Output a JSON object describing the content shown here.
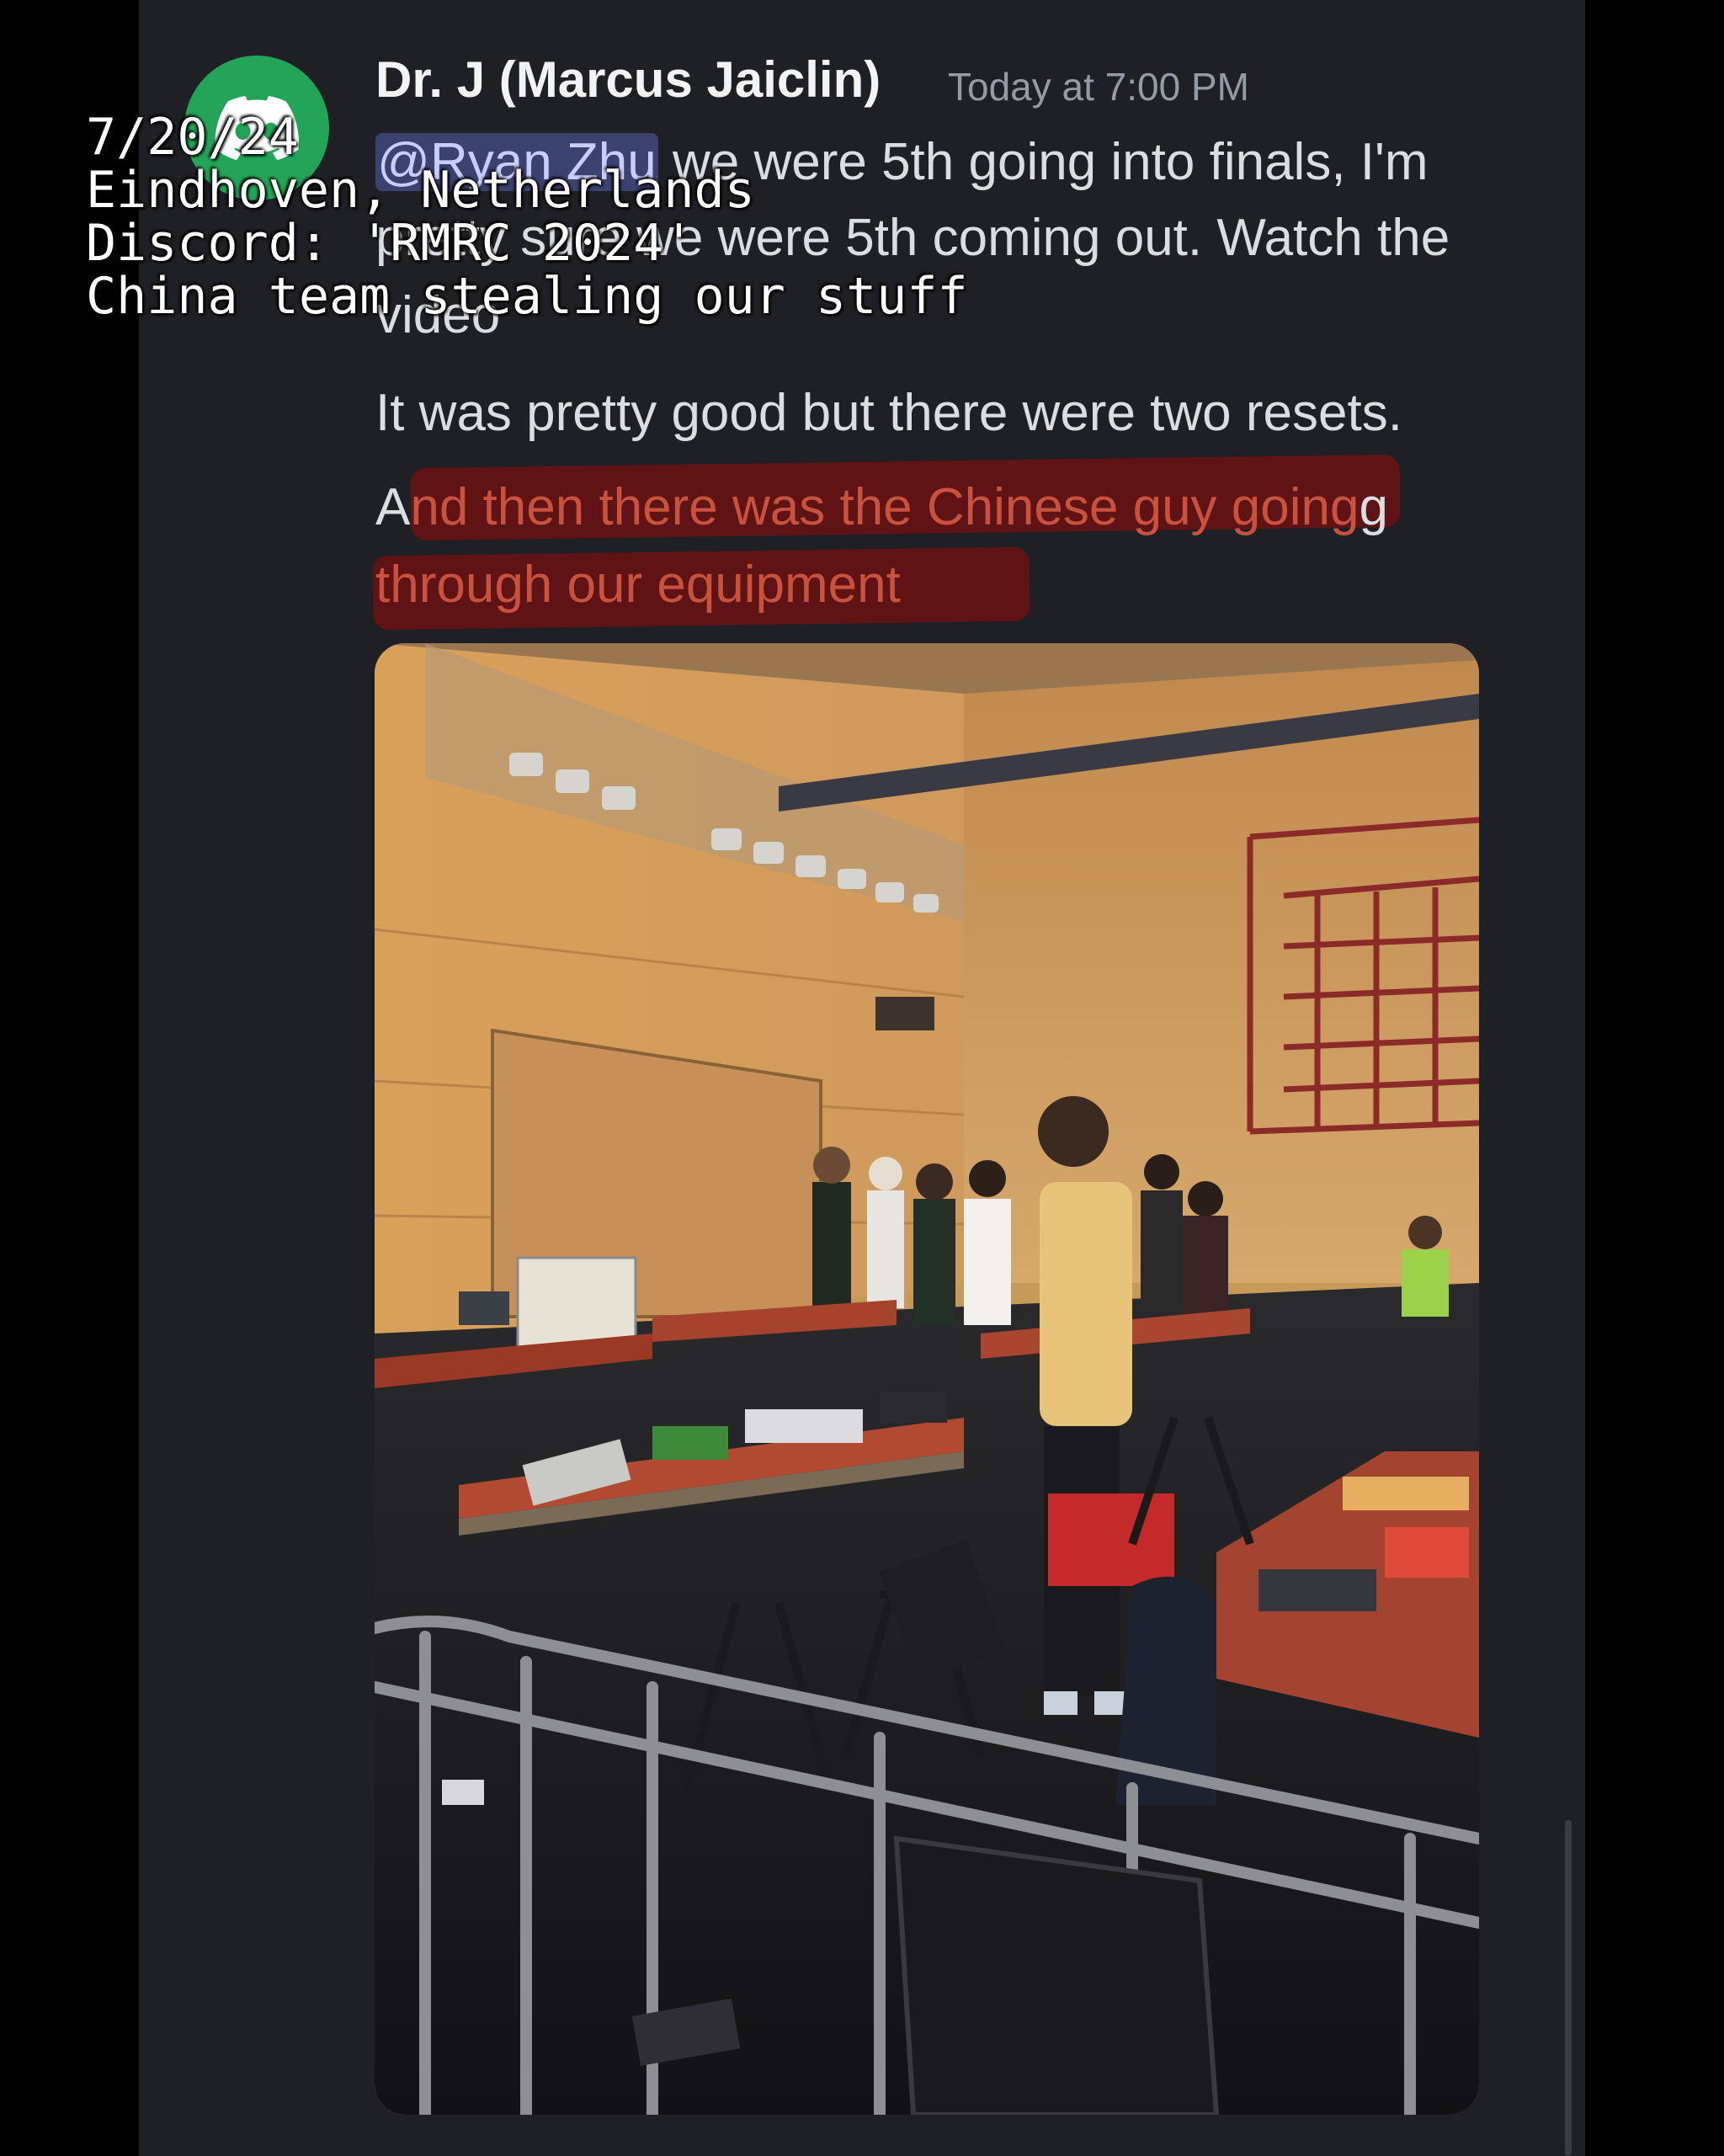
{
  "message": {
    "author": "Dr. J (Marcus Jaiclin)",
    "timestamp": "Today at 7:00 PM",
    "mention": "@Ryan Zhu",
    "line1_rest": " we were 5th going into finals, I'm",
    "line2": "pretty sure we were 5th coming out. Watch the",
    "line3": "video",
    "line4": "It was pretty good but there were two resets.",
    "line5_start": "A",
    "line5_highlight": "nd then there was the Chinese guy going",
    "line5_end": "g",
    "line6": "through our equipment"
  },
  "overlay": {
    "line1": "7/20/24",
    "line2": "Eindhoven, Netherlands",
    "line3": "Discord: 'RMRC 2024'",
    "line4": "China team stealing our stuff"
  },
  "colors": {
    "background": "#1f2025",
    "avatar": "#23a559",
    "mention_bg": "#3c4270",
    "highlight": "#780e0e"
  },
  "icons": {
    "avatar": "discord-logo-icon"
  }
}
